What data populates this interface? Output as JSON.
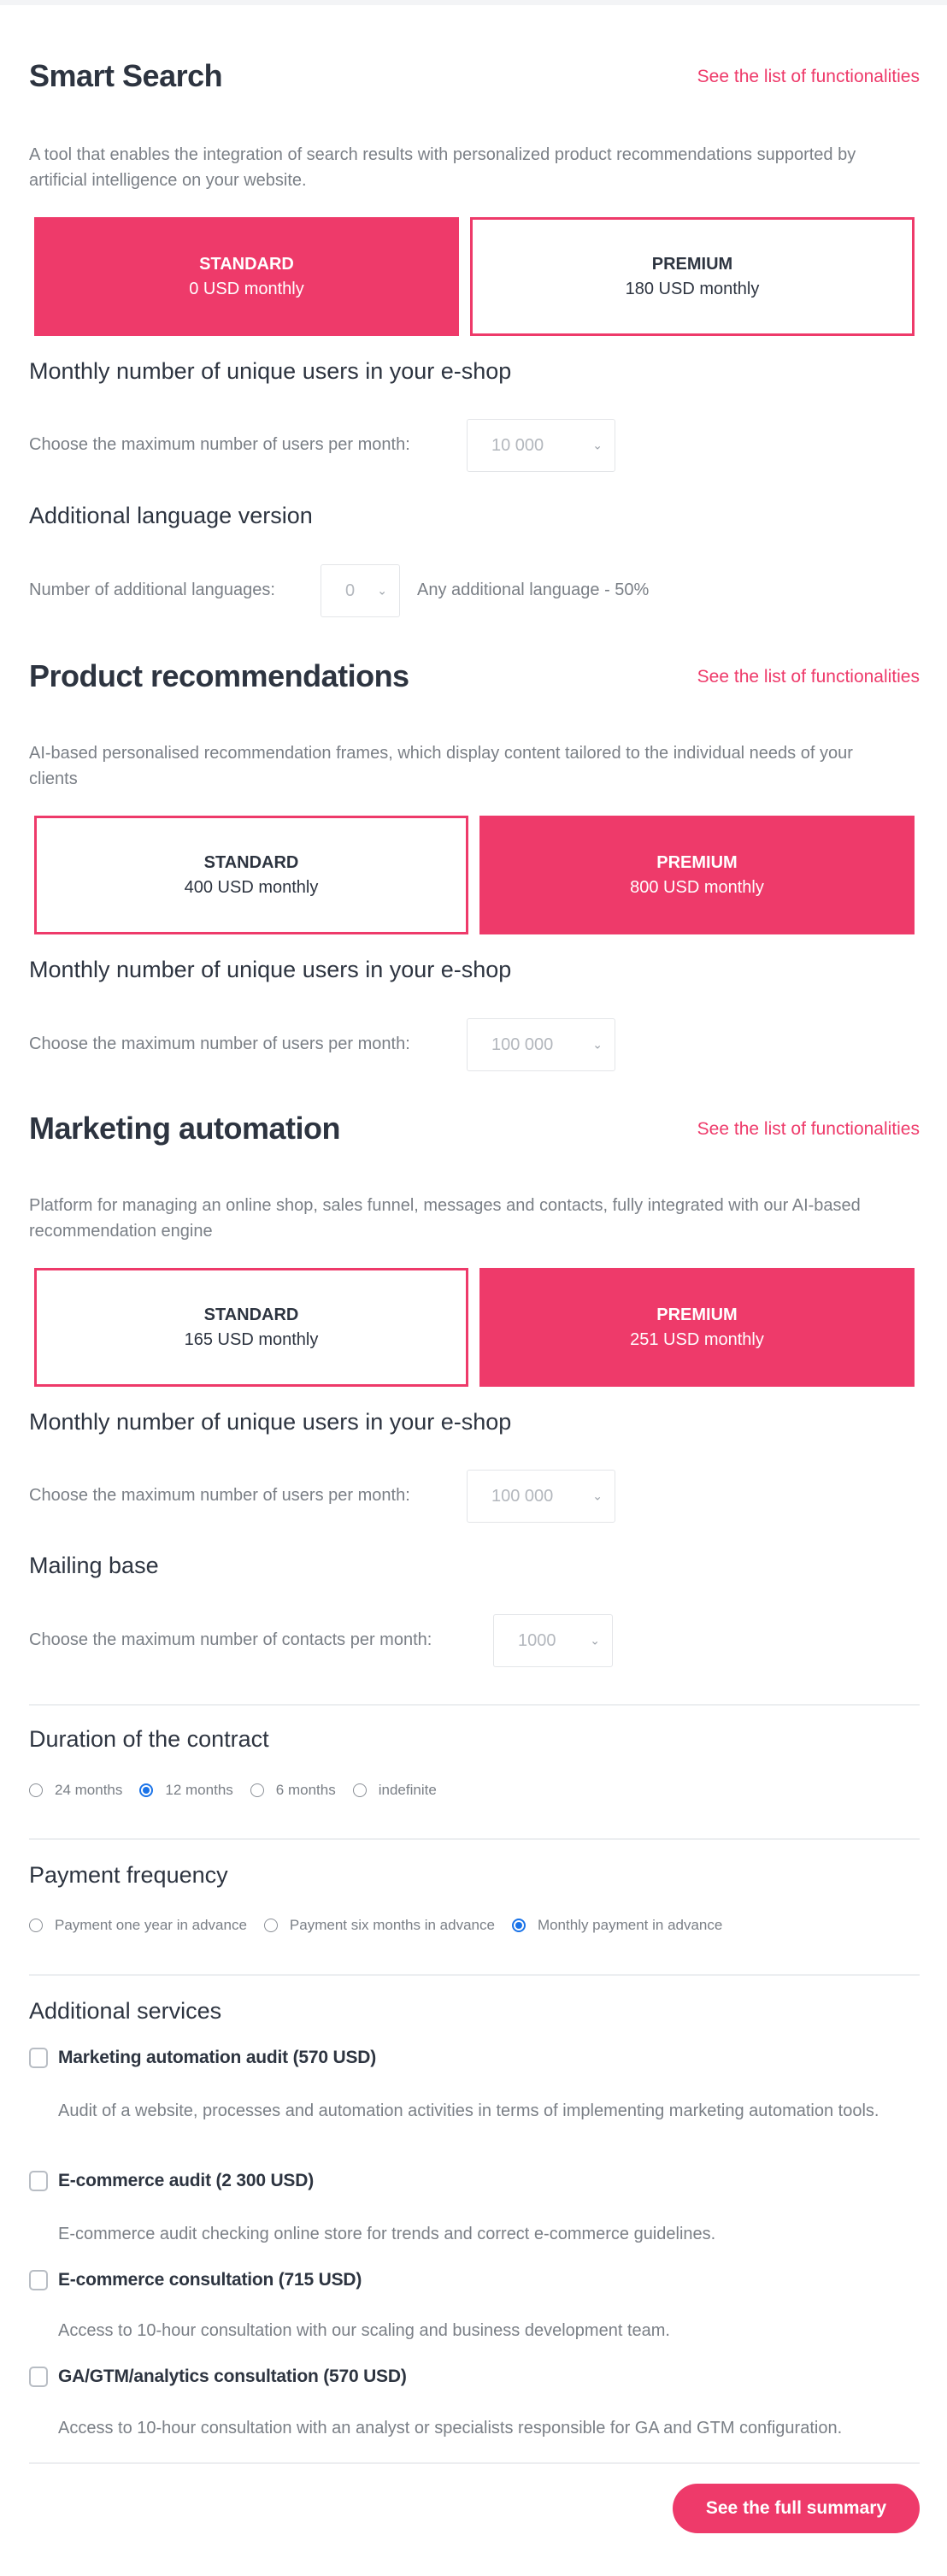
{
  "functionalities_link": "See the list of functionalities",
  "colors": {
    "accent": "#EE3A6A",
    "heading": "#2D3440",
    "muted": "#7A7F86",
    "radio_checked": "#1A73E8"
  },
  "smart_search": {
    "title": "Smart Search",
    "description": "A tool that enables the integration of search results with personalized product recommendations supported by artificial intelligence on your website.",
    "plans": [
      {
        "name": "STANDARD",
        "price": "0 USD monthly",
        "selected": true
      },
      {
        "name": "PREMIUM",
        "price": "180 USD monthly",
        "selected": false
      }
    ],
    "users_heading": "Monthly number of unique users in your e-shop",
    "users_label": "Choose the maximum number of users per month:",
    "users_value": "10 000",
    "language_heading": "Additional language version",
    "language_label": "Number of additional languages:",
    "language_value": "0",
    "language_note": "Any additional language - 50%"
  },
  "product_recommendations": {
    "title": "Product recommendations",
    "description": "AI-based personalised recommendation frames, which display content tailored to the individual needs of your clients",
    "plans": [
      {
        "name": "STANDARD",
        "price": "400 USD monthly",
        "selected": false
      },
      {
        "name": "PREMIUM",
        "price": "800 USD monthly",
        "selected": true
      }
    ],
    "users_heading": "Monthly number of unique users in your e-shop",
    "users_label": "Choose the maximum number of users per month:",
    "users_value": "100 000"
  },
  "marketing_automation": {
    "title": "Marketing automation",
    "description": "Platform for managing an online shop, sales funnel, messages and contacts, fully integrated with our AI-based recommendation engine",
    "plans": [
      {
        "name": "STANDARD",
        "price": "165 USD monthly",
        "selected": false
      },
      {
        "name": "PREMIUM",
        "price": "251 USD monthly",
        "selected": true
      }
    ],
    "users_heading": "Monthly number of unique users in your e-shop",
    "users_label": "Choose the maximum number of users per month:",
    "users_value": "100 000",
    "mailing_heading": "Mailing base",
    "mailing_label": "Choose the maximum number of contacts per month:",
    "mailing_value": "1000"
  },
  "duration": {
    "heading": "Duration of the contract",
    "options": [
      {
        "label": "24 months",
        "checked": false
      },
      {
        "label": "12 months",
        "checked": true
      },
      {
        "label": "6 months",
        "checked": false
      },
      {
        "label": "indefinite",
        "checked": false
      }
    ]
  },
  "payment": {
    "heading": "Payment frequency",
    "options": [
      {
        "label": "Payment one year in advance",
        "checked": false
      },
      {
        "label": "Payment six months in advance",
        "checked": false
      },
      {
        "label": "Monthly payment in advance",
        "checked": true
      }
    ]
  },
  "services": {
    "heading": "Additional services",
    "items": [
      {
        "label": "Marketing automation audit (570 USD)",
        "description": "Audit of a website, processes and automation activities in terms of implementing marketing automation tools.",
        "checked": false
      },
      {
        "label": "E-commerce audit (2 300 USD)",
        "description": "E-commerce audit checking online store for trends and correct e-commerce guidelines.",
        "checked": false
      },
      {
        "label": "E-commerce consultation (715 USD)",
        "description": "Access to 10-hour consultation with our scaling and business development team.",
        "checked": false
      },
      {
        "label": "GA/GTM/analytics consultation (570 USD)",
        "description": "Access to 10-hour consultation with an analyst or specialists responsible for GA and GTM configuration.",
        "checked": false
      }
    ]
  },
  "cta": {
    "label": "See the full summary"
  }
}
